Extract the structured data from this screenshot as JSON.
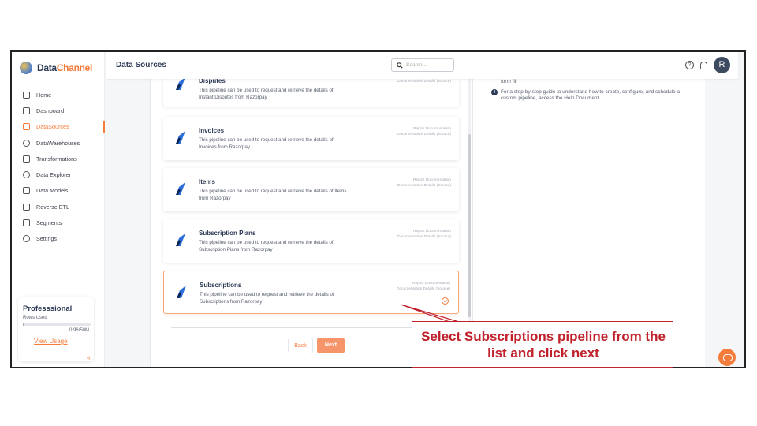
{
  "brand": {
    "name_part1": "Data",
    "name_part2": "Channel"
  },
  "header": {
    "title": "Data Sources",
    "search_placeholder": "Search...",
    "avatar_initial": "R",
    "help_glyph": "?"
  },
  "sidebar": {
    "items": [
      {
        "label": "Home",
        "icon": "home-icon"
      },
      {
        "label": "Dashboard",
        "icon": "dashboard-icon"
      },
      {
        "label": "DataSources",
        "icon": "datasources-icon",
        "active": true
      },
      {
        "label": "DataWarehouses",
        "icon": "database-icon"
      },
      {
        "label": "Transformations",
        "icon": "transform-icon"
      },
      {
        "label": "Data Explorer",
        "icon": "explorer-icon"
      },
      {
        "label": "Data Models",
        "icon": "models-icon"
      },
      {
        "label": "Reverse ETL",
        "icon": "reverse-etl-icon"
      },
      {
        "label": "Segments",
        "icon": "segments-icon"
      },
      {
        "label": "Settings",
        "icon": "settings-icon"
      }
    ]
  },
  "plan": {
    "title": "Professsional",
    "rows_label": "Rows Used",
    "usage": "0.96/50M",
    "usage_fraction": 0.02,
    "link": "View Usage",
    "collapse_glyph": "«"
  },
  "pipelines": [
    {
      "title": "Disputes",
      "desc": "This pipeline can be used to request and retrieve the details of Instant Disputes from Razorpay",
      "link1": "",
      "link2": "Documentation Details (Source)"
    },
    {
      "title": "Invoices",
      "desc": "This pipeline can be used to request and retrieve the details of Invoices from Razorpay",
      "link1": "Report Documentation",
      "link2": "Documentation Details (Source)"
    },
    {
      "title": "Items",
      "desc": "This pipeline can be used to request and retrieve the details of Items from Razorpay",
      "link1": "Report Documentation",
      "link2": "Documentation Details (Source)"
    },
    {
      "title": "Subscription Plans",
      "desc": "This pipeline can be used to request and retrieve the details of Subscription Plans from Razorpay",
      "link1": "Report Documentation",
      "link2": "Documentation Details (Source)"
    },
    {
      "title": "Subscriptions",
      "desc": "This pipeline can be used to request and retrieve the details of Subscriptions from Razorpay",
      "link1": "Report Documentation",
      "link2": "Documentation Details (Source)",
      "selected": true
    }
  ],
  "buttons": {
    "back": "Back",
    "next": "Next"
  },
  "help": {
    "step2_tail": "name the pipeline. Detailed instructions have been provided at every step to aid the form fill",
    "step3_num": "3",
    "step3": "For a step-by-step guide to understand how to create, configure, and schedule a custom pipeline, access the Help Document."
  },
  "callout": {
    "text": "Select Subscriptions pipeline from the list and click next"
  },
  "colors": {
    "accent": "#f47b3a",
    "callout": "#c0212b",
    "navy": "#2d3a55"
  }
}
